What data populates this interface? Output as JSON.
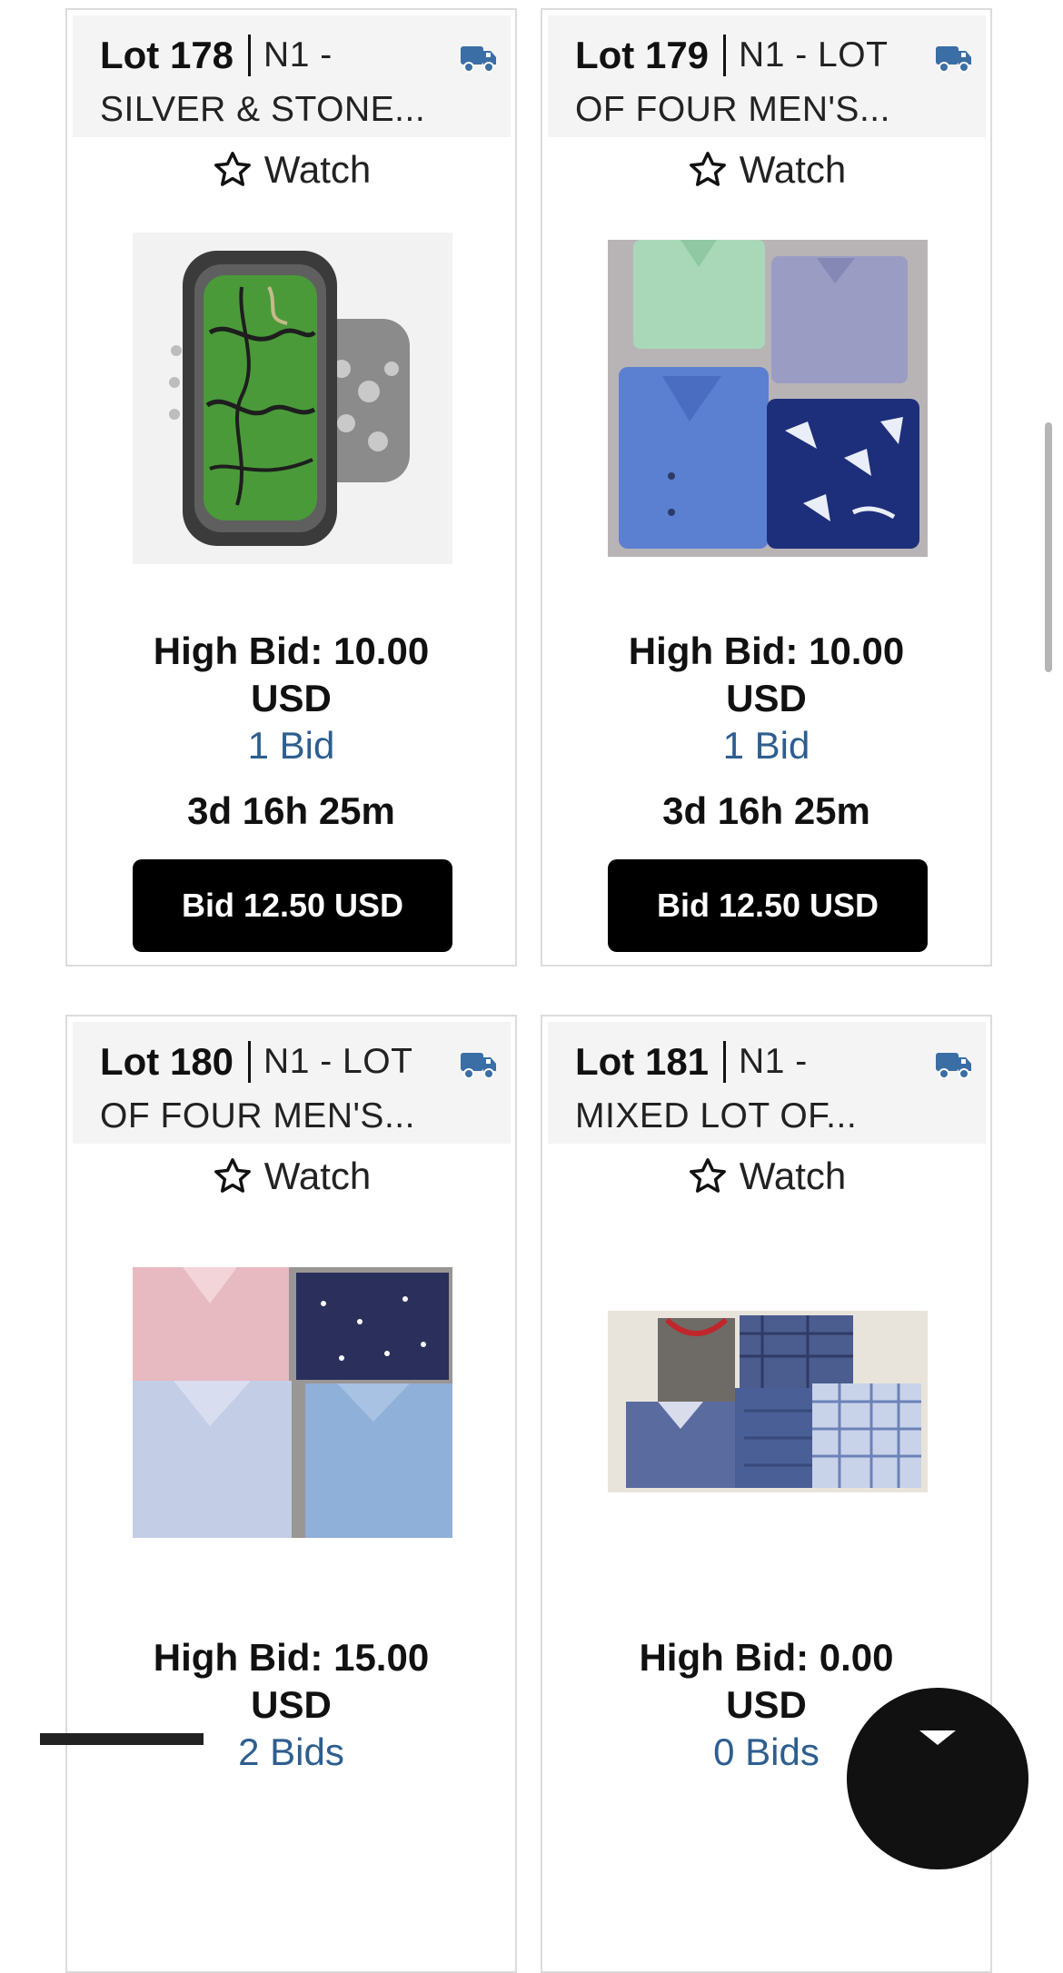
{
  "lots": [
    {
      "lot_label": "Lot 178",
      "title_line1": "N1 -",
      "title_line2": "SILVER & STONE...",
      "watch_label": "Watch",
      "high_bid": "High Bid: 10.00",
      "currency": "USD",
      "bid_count": "1 Bid",
      "time_left": "3d 16h 25m",
      "bid_button": "Bid 12.50 USD",
      "image": "green-stone-silver-ring"
    },
    {
      "lot_label": "Lot 179",
      "title_line1": "N1 - LOT",
      "title_line2": "OF FOUR MEN'S...",
      "watch_label": "Watch",
      "high_bid": "High Bid: 10.00",
      "currency": "USD",
      "bid_count": "1 Bid",
      "time_left": "3d 16h 25m",
      "bid_button": "Bid 12.50 USD",
      "image": "four-mens-shirts"
    },
    {
      "lot_label": "Lot 180",
      "title_line1": "N1 - LOT",
      "title_line2": "OF FOUR MEN'S...",
      "watch_label": "Watch",
      "high_bid": "High Bid: 15.00",
      "currency": "USD",
      "bid_count": "2 Bids",
      "image": "four-dress-shirts"
    },
    {
      "lot_label": "Lot 181",
      "title_line1": "N1 -",
      "title_line2": "MIXED LOT OF...",
      "watch_label": "Watch",
      "high_bid": "High Bid: 0.00",
      "currency": "USD",
      "bid_count": "0 Bids",
      "image": "mixed-pajama-lot"
    }
  ],
  "icons": {
    "shipping": "truck-icon",
    "watch": "star-outline-icon",
    "fab": "chevron-down-icon"
  },
  "colors": {
    "bid_link": "#2d5e8f",
    "truck_icon": "#3a6ea5",
    "button_bg": "#000000",
    "header_bg": "#f4f4f4"
  }
}
